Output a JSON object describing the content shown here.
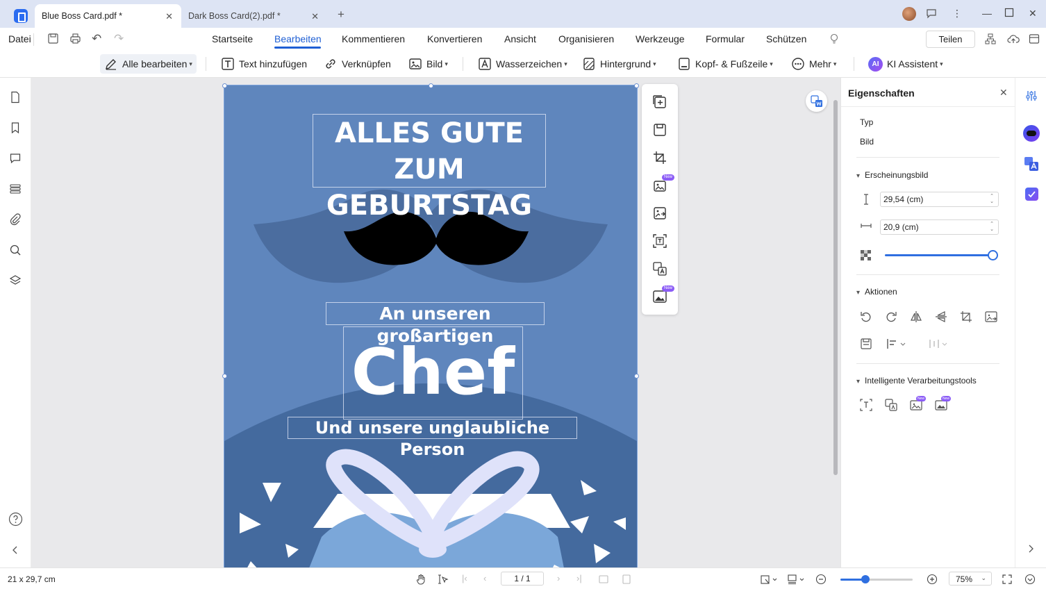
{
  "tabs": [
    {
      "title": "Blue Boss Card.pdf *",
      "active": true
    },
    {
      "title": "Dark Boss Card(2).pdf *",
      "active": false
    }
  ],
  "menu": {
    "file": "Datei",
    "items": [
      "Startseite",
      "Bearbeiten",
      "Kommentieren",
      "Konvertieren",
      "Ansicht",
      "Organisieren",
      "Werkzeuge",
      "Formular",
      "Schützen"
    ],
    "active": "Bearbeiten",
    "share": "Teilen"
  },
  "toolbar": {
    "edit_all": "Alle bearbeiten",
    "add_text": "Text hinzufügen",
    "link": "Verknüpfen",
    "image": "Bild",
    "watermark": "Wasserzeichen",
    "background": "Hintergrund",
    "header_footer": "Kopf- & Fußzeile",
    "more": "Mehr",
    "ai": "KI Assistent",
    "ai_badge": "AI"
  },
  "card": {
    "headline_1": "ALLES GUTE ZUM",
    "headline_2": "GEBURTSTAG",
    "line_1": "An unseren großartigen",
    "big_word": "Chef",
    "line_2": "Und unsere unglaubliche Person"
  },
  "floating_toolbar": {
    "new_badge": "New"
  },
  "properties": {
    "title": "Eigenschaften",
    "type_label": "Typ",
    "type_value": "Bild",
    "appearance_section": "Erscheinungsbild",
    "height_value": "29,54 (cm)",
    "width_value": "20,9 (cm)",
    "opacity": 1.0,
    "actions_section": "Aktionen",
    "smart_tools_section": "Intelligente Verarbeitungstools"
  },
  "status": {
    "page_size": "21 x 29,7 cm",
    "page_indicator": "1 / 1",
    "zoom": "75%",
    "zoom_level": 0.35
  },
  "colors": {
    "accent": "#1f5fd4",
    "card_blue": "#5f86bd",
    "card_dark_blue": "#446a9e",
    "ribbon": "#dfe2fa"
  }
}
